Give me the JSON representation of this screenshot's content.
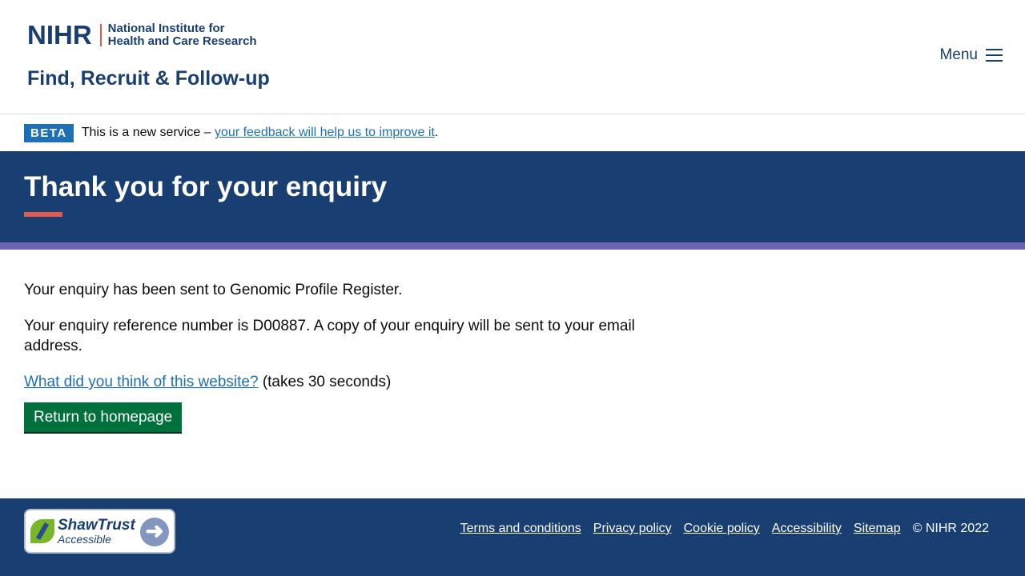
{
  "header": {
    "logo_mark": "NIHR",
    "logo_line1": "National Institute for",
    "logo_line2": "Health and Care Research",
    "service_name": "Find, Recruit & Follow-up",
    "menu_label": "Menu"
  },
  "beta": {
    "tag": "BETA",
    "text": "This is a new service – ",
    "link": "your feedback will help us to improve it",
    "suffix": "."
  },
  "hero": {
    "title": "Thank you for your enquiry"
  },
  "content": {
    "sent_message": "Your enquiry has been sent to Genomic Profile Register.",
    "reference_message": "Your enquiry reference number is D00887. A copy of your enquiry will be sent to your email address.",
    "survey_link": "What did you think of this website?",
    "survey_suffix": " (takes 30 seconds)",
    "return_button": "Return to homepage"
  },
  "footer": {
    "badge_name": "ShawTrust",
    "badge_sub": "Accessible",
    "links": [
      "Terms and conditions",
      "Privacy policy",
      "Cookie policy",
      "Accessibility",
      "Sitemap"
    ],
    "copyright": "© NIHR 2022"
  },
  "colors": {
    "brand_navy": "#193e72",
    "accent_coral": "#e05a4e",
    "strip_purple": "#6c64b2",
    "link_blue": "#1d70b8",
    "button_green": "#00703c"
  }
}
